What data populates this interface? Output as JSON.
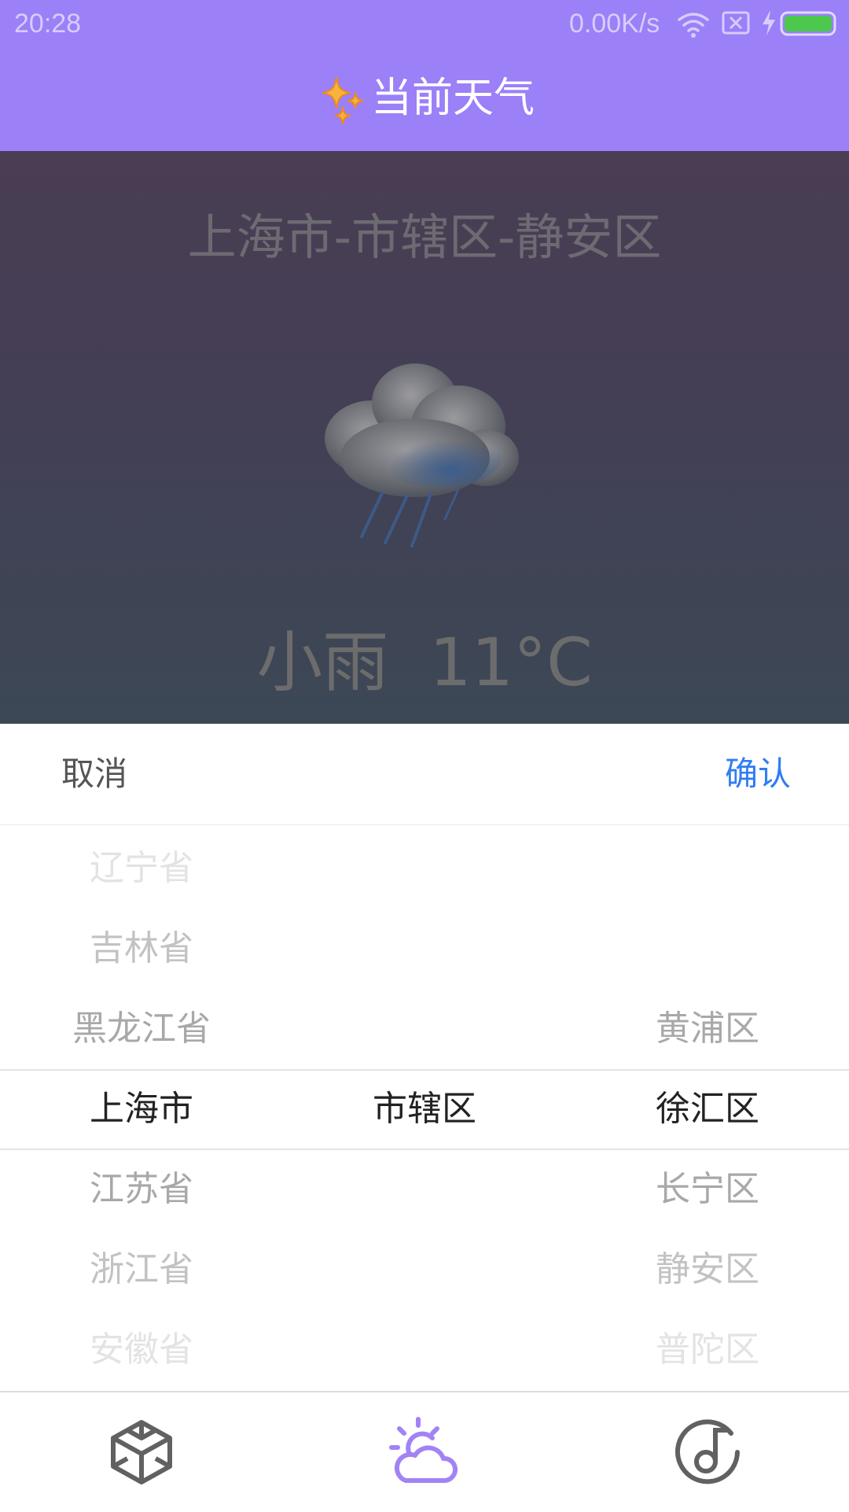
{
  "status_bar": {
    "time": "20:28",
    "net_speed": "0.00K/s",
    "icons": [
      "wifi-icon",
      "sim-off-icon",
      "charging-icon",
      "battery-icon"
    ]
  },
  "header": {
    "icon": "sparkle-icon",
    "title": "当前天气"
  },
  "weather": {
    "location": "上海市-市辖区-静安区",
    "condition_icon": "rain-cloud-icon",
    "condition": "小雨",
    "temperature": "11°C"
  },
  "picker": {
    "cancel_label": "取消",
    "confirm_label": "确认",
    "province": {
      "items": [
        "辽宁省",
        "吉林省",
        "黑龙江省",
        "上海市",
        "江苏省",
        "浙江省",
        "安徽省"
      ],
      "selected": "上海市"
    },
    "city": {
      "items": [
        "市辖区"
      ],
      "selected": "市辖区"
    },
    "district": {
      "items": [
        "黄浦区",
        "徐汇区",
        "长宁区",
        "静安区",
        "普陀区"
      ],
      "selected": "徐汇区"
    }
  },
  "bottom_nav": {
    "items": [
      {
        "icon": "cube-icon",
        "active": false
      },
      {
        "icon": "weather-icon",
        "active": true
      },
      {
        "icon": "music-icon",
        "active": false
      }
    ]
  },
  "colors": {
    "accent": "#9b80f8",
    "confirm": "#2f7df3",
    "nav_active": "#a283f5",
    "nav_inactive": "#616161"
  }
}
